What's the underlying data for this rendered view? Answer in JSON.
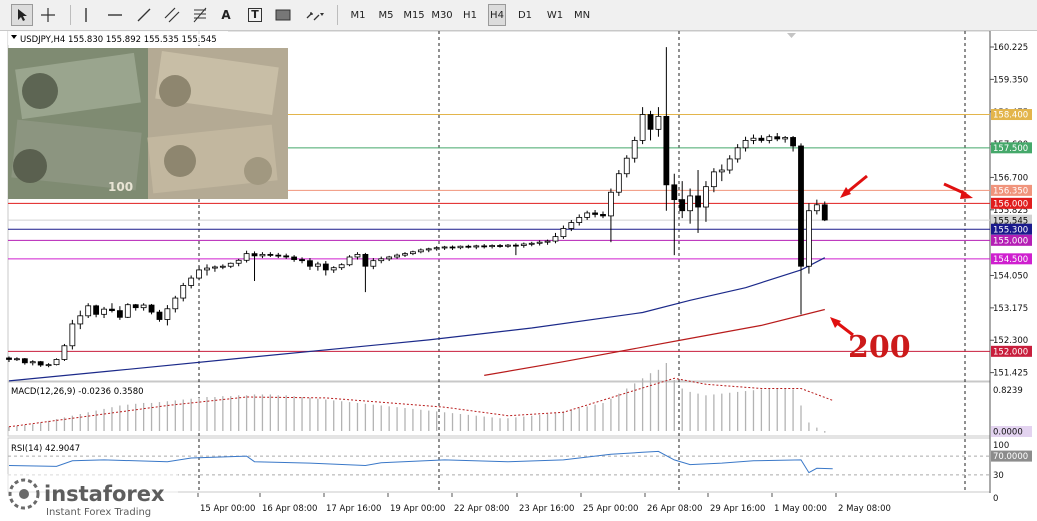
{
  "toolbar": {
    "tools": [
      {
        "name": "cursor-icon"
      },
      {
        "name": "crosshair-icon"
      },
      {
        "name": "vertical-line-icon"
      },
      {
        "name": "horizontal-line-icon"
      },
      {
        "name": "trendline-icon"
      },
      {
        "name": "equidistant-channel-icon"
      },
      {
        "name": "fibonacci-icon"
      },
      {
        "name": "text-icon",
        "glyph": "A"
      },
      {
        "name": "text-label-icon",
        "glyph": "T"
      },
      {
        "name": "rectangle-shape-icon"
      },
      {
        "name": "arrows-menu-icon"
      }
    ],
    "timeframes": [
      "M1",
      "M5",
      "M15",
      "M30",
      "H1",
      "H4",
      "D1",
      "W1",
      "MN"
    ],
    "active_timeframe": "H4"
  },
  "header": {
    "symbol_line": "USDJPY,H4  155.830 155.892 155.535 155.545"
  },
  "price_axis": {
    "ticks": [
      "160.225",
      "159.350",
      "158.475",
      "157.600",
      "156.700",
      "155.825",
      "154.050",
      "153.175",
      "152.300",
      "151.425"
    ]
  },
  "levels": [
    {
      "label": "158.400",
      "value": 158.4,
      "color": "#e3b54b",
      "text_color": "#ffffff"
    },
    {
      "label": "157.500",
      "value": 157.5,
      "color": "#45a86a",
      "text_color": "#ffffff"
    },
    {
      "label": "156.350",
      "value": 156.35,
      "color": "#f0947c",
      "text_color": "#ffffff"
    },
    {
      "label": "156.000",
      "value": 156.0,
      "color": "#e11d1d",
      "text_color": "#ffffff"
    },
    {
      "label": "155.545",
      "value": 155.545,
      "color": "#d2d2d2",
      "text_color": "#000000"
    },
    {
      "label": "155.300",
      "value": 155.3,
      "color": "#1a1a8c",
      "text_color": "#ffffff"
    },
    {
      "label": "155.000",
      "value": 155.0,
      "color": "#b51fb5",
      "text_color": "#ffffff"
    },
    {
      "label": "154.500",
      "value": 154.5,
      "color": "#cf1fcf",
      "text_color": "#ffffff"
    },
    {
      "label": "152.000",
      "value": 152.0,
      "color": "#c81e3c",
      "text_color": "#ffffff"
    }
  ],
  "macd": {
    "label": "MACD(12,26,9) -0.0236 0.3580",
    "axis_top": "0.8239",
    "axis_zero": "0.0000"
  },
  "rsi": {
    "label": "RSI(14) 42.9047",
    "axis": [
      "100",
      "70.0000",
      "30",
      "0"
    ]
  },
  "time_axis": [
    "15 Apr 00:00",
    "16 Apr 08:00",
    "17 Apr 16:00",
    "19 Apr 00:00",
    "22 Apr 08:00",
    "23 Apr 16:00",
    "25 Apr 00:00",
    "26 Apr 08:00",
    "29 Apr 16:00",
    "1 May 00:00",
    "2 May 08:00"
  ],
  "annotation": {
    "text": "200",
    "color": "#cc1a1a"
  },
  "watermark": {
    "brand": "instaforex",
    "tagline": "Instant Forex Trading"
  },
  "chart_data": {
    "type": "candlestick",
    "symbol": "USDJPY",
    "timeframe": "H4",
    "y_range": [
      151.2,
      160.55
    ],
    "candles": [
      [
        151.82,
        151.86,
        151.71,
        151.78
      ],
      [
        151.78,
        151.84,
        151.74,
        151.8
      ],
      [
        151.8,
        151.82,
        151.64,
        151.69
      ],
      [
        151.69,
        151.76,
        151.62,
        151.72
      ],
      [
        151.72,
        151.74,
        151.58,
        151.63
      ],
      [
        151.63,
        151.68,
        151.57,
        151.64
      ],
      [
        151.64,
        151.81,
        151.62,
        151.78
      ],
      [
        151.78,
        152.2,
        151.74,
        152.15
      ],
      [
        152.15,
        152.85,
        152.05,
        152.74
      ],
      [
        152.74,
        153.1,
        152.6,
        152.96
      ],
      [
        152.96,
        153.3,
        152.9,
        153.23
      ],
      [
        153.23,
        153.26,
        152.92,
        153.0
      ],
      [
        153.0,
        153.2,
        152.9,
        153.14
      ],
      [
        153.14,
        153.3,
        153.05,
        153.1
      ],
      [
        153.1,
        153.22,
        152.85,
        152.92
      ],
      [
        152.92,
        153.3,
        152.9,
        153.26
      ],
      [
        153.26,
        153.28,
        153.1,
        153.18
      ],
      [
        153.18,
        153.3,
        153.1,
        153.25
      ],
      [
        153.25,
        153.28,
        153.0,
        153.06
      ],
      [
        153.06,
        153.12,
        152.8,
        152.86
      ],
      [
        152.86,
        153.25,
        152.7,
        153.15
      ],
      [
        153.15,
        153.5,
        153.05,
        153.44
      ],
      [
        153.44,
        153.85,
        153.35,
        153.78
      ],
      [
        153.78,
        154.05,
        153.7,
        153.98
      ],
      [
        153.98,
        154.3,
        153.92,
        154.2
      ],
      [
        154.2,
        154.35,
        154.05,
        154.25
      ],
      [
        154.25,
        154.32,
        154.15,
        154.28
      ],
      [
        154.28,
        154.35,
        154.22,
        154.3
      ],
      [
        154.3,
        154.4,
        154.25,
        154.38
      ],
      [
        154.38,
        154.5,
        154.3,
        154.46
      ],
      [
        154.46,
        154.72,
        154.4,
        154.64
      ],
      [
        154.64,
        154.7,
        153.9,
        154.58
      ],
      [
        154.58,
        154.68,
        154.52,
        154.62
      ],
      [
        154.62,
        154.68,
        154.55,
        154.6
      ],
      [
        154.6,
        154.66,
        154.52,
        154.58
      ],
      [
        154.58,
        154.64,
        154.5,
        154.55
      ],
      [
        154.55,
        154.6,
        154.42,
        154.48
      ],
      [
        154.48,
        154.54,
        154.38,
        154.45
      ],
      [
        154.45,
        154.52,
        154.2,
        154.3
      ],
      [
        154.3,
        154.42,
        154.18,
        154.36
      ],
      [
        154.36,
        154.44,
        154.05,
        154.2
      ],
      [
        154.2,
        154.3,
        154.12,
        154.26
      ],
      [
        154.26,
        154.38,
        154.2,
        154.34
      ],
      [
        154.34,
        154.6,
        154.3,
        154.55
      ],
      [
        154.55,
        154.68,
        154.48,
        154.62
      ],
      [
        154.62,
        154.66,
        153.6,
        154.3
      ],
      [
        154.3,
        154.52,
        154.22,
        154.45
      ],
      [
        154.45,
        154.56,
        154.38,
        154.5
      ],
      [
        154.5,
        154.58,
        154.44,
        154.55
      ],
      [
        154.55,
        154.64,
        154.5,
        154.6
      ],
      [
        154.6,
        154.68,
        154.55,
        154.64
      ],
      [
        154.64,
        154.72,
        154.6,
        154.69
      ],
      [
        154.69,
        154.78,
        154.65,
        154.74
      ],
      [
        154.74,
        154.8,
        154.68,
        154.77
      ],
      [
        154.77,
        154.84,
        154.72,
        154.8
      ],
      [
        154.8,
        154.85,
        154.74,
        154.82
      ],
      [
        154.82,
        154.86,
        154.74,
        154.8
      ],
      [
        154.8,
        154.86,
        154.76,
        154.84
      ],
      [
        154.84,
        154.88,
        154.78,
        154.82
      ],
      [
        154.82,
        154.88,
        154.76,
        154.85
      ],
      [
        154.85,
        154.9,
        154.78,
        154.83
      ],
      [
        154.83,
        154.89,
        154.78,
        154.86
      ],
      [
        154.86,
        154.9,
        154.8,
        154.84
      ],
      [
        154.84,
        154.9,
        154.8,
        154.87
      ],
      [
        154.87,
        154.92,
        154.6,
        154.86
      ],
      [
        154.86,
        154.94,
        154.8,
        154.9
      ],
      [
        154.9,
        154.96,
        154.84,
        154.92
      ],
      [
        154.92,
        155.0,
        154.86,
        154.95
      ],
      [
        154.95,
        155.02,
        154.88,
        154.98
      ],
      [
        154.98,
        155.2,
        154.92,
        155.1
      ],
      [
        155.1,
        155.4,
        155.04,
        155.32
      ],
      [
        155.32,
        155.55,
        155.25,
        155.48
      ],
      [
        155.48,
        155.7,
        155.4,
        155.62
      ],
      [
        155.62,
        155.8,
        155.55,
        155.74
      ],
      [
        155.74,
        155.82,
        155.62,
        155.7
      ],
      [
        155.7,
        155.78,
        155.6,
        155.66
      ],
      [
        155.66,
        156.4,
        154.95,
        156.3
      ],
      [
        156.3,
        156.9,
        156.2,
        156.8
      ],
      [
        156.8,
        157.3,
        156.7,
        157.22
      ],
      [
        157.22,
        157.8,
        157.1,
        157.7
      ],
      [
        157.7,
        158.6,
        157.6,
        158.4
      ],
      [
        158.4,
        158.5,
        157.7,
        158.0
      ],
      [
        158.0,
        158.6,
        157.8,
        158.35
      ],
      [
        158.35,
        160.22,
        155.8,
        156.5
      ],
      [
        156.5,
        156.8,
        154.6,
        156.1
      ],
      [
        156.1,
        156.6,
        155.6,
        155.8
      ],
      [
        155.8,
        156.4,
        155.45,
        156.2
      ],
      [
        156.2,
        156.9,
        155.2,
        155.9
      ],
      [
        155.9,
        156.6,
        155.5,
        156.45
      ],
      [
        156.45,
        156.95,
        156.3,
        156.85
      ],
      [
        156.85,
        157.05,
        156.6,
        156.9
      ],
      [
        156.9,
        157.3,
        156.8,
        157.2
      ],
      [
        157.2,
        157.6,
        157.1,
        157.5
      ],
      [
        157.5,
        157.8,
        157.4,
        157.7
      ],
      [
        157.7,
        157.86,
        157.6,
        157.76
      ],
      [
        157.76,
        157.84,
        157.64,
        157.7
      ],
      [
        157.7,
        157.86,
        157.62,
        157.8
      ],
      [
        157.8,
        157.9,
        157.68,
        157.74
      ],
      [
        157.74,
        157.82,
        157.64,
        157.78
      ],
      [
        157.78,
        157.82,
        157.4,
        157.55
      ],
      [
        157.55,
        157.62,
        153.0,
        154.3
      ],
      [
        154.3,
        156.0,
        154.1,
        155.8
      ],
      [
        155.8,
        156.1,
        155.7,
        155.96
      ],
      [
        155.96,
        156.05,
        155.52,
        155.55
      ]
    ],
    "ma_blue": [
      [
        0,
        151.2
      ],
      [
        13,
        151.47
      ],
      [
        30,
        151.83
      ],
      [
        53,
        152.31
      ],
      [
        66,
        152.63
      ],
      [
        80,
        153.05
      ],
      [
        86,
        153.38
      ],
      [
        93,
        153.72
      ],
      [
        100,
        154.2
      ],
      [
        103,
        154.53
      ]
    ],
    "ma_red": [
      [
        60,
        151.35
      ],
      [
        70,
        151.72
      ],
      [
        85,
        152.31
      ],
      [
        95,
        152.7
      ],
      [
        103,
        153.13
      ]
    ],
    "macd_hist": [
      0.05,
      0.06,
      0.07,
      0.08,
      0.1,
      0.12,
      0.14,
      0.16,
      0.18,
      0.2,
      0.22,
      0.24,
      0.26,
      0.28,
      0.3,
      0.31,
      0.32,
      0.33,
      0.33,
      0.34,
      0.35,
      0.36,
      0.37,
      0.38,
      0.39,
      0.4,
      0.4,
      0.41,
      0.41,
      0.42,
      0.42,
      0.43,
      0.43,
      0.43,
      0.42,
      0.42,
      0.41,
      0.4,
      0.39,
      0.38,
      0.37,
      0.36,
      0.35,
      0.34,
      0.33,
      0.32,
      0.31,
      0.3,
      0.29,
      0.28,
      0.27,
      0.26,
      0.25,
      0.24,
      0.23,
      0.22,
      0.21,
      0.2,
      0.19,
      0.18,
      0.17,
      0.16,
      0.15,
      0.15,
      0.16,
      0.17,
      0.18,
      0.19,
      0.2,
      0.21,
      0.23,
      0.25,
      0.27,
      0.29,
      0.31,
      0.33,
      0.38,
      0.44,
      0.5,
      0.56,
      0.62,
      0.68,
      0.72,
      0.8,
      0.6,
      0.5,
      0.46,
      0.44,
      0.42,
      0.43,
      0.44,
      0.45,
      0.46,
      0.47,
      0.48,
      0.49,
      0.5,
      0.5,
      0.5,
      0.49,
      0.3,
      0.1,
      0.04,
      -0.02
    ],
    "macd_signal": [
      [
        0,
        0.05
      ],
      [
        20,
        0.3
      ],
      [
        30,
        0.4
      ],
      [
        40,
        0.39
      ],
      [
        55,
        0.28
      ],
      [
        63,
        0.18
      ],
      [
        70,
        0.22
      ],
      [
        78,
        0.45
      ],
      [
        84,
        0.62
      ],
      [
        88,
        0.55
      ],
      [
        95,
        0.5
      ],
      [
        100,
        0.5
      ],
      [
        104,
        0.36
      ]
    ],
    "rsi": [
      [
        0,
        50
      ],
      [
        6,
        48
      ],
      [
        8,
        60
      ],
      [
        12,
        62
      ],
      [
        20,
        58
      ],
      [
        23,
        66
      ],
      [
        30,
        70
      ],
      [
        31,
        58
      ],
      [
        38,
        55
      ],
      [
        45,
        50
      ],
      [
        47,
        56
      ],
      [
        55,
        62
      ],
      [
        63,
        58
      ],
      [
        70,
        62
      ],
      [
        76,
        74
      ],
      [
        80,
        78
      ],
      [
        82,
        80
      ],
      [
        84,
        62
      ],
      [
        86,
        52
      ],
      [
        90,
        55
      ],
      [
        94,
        60
      ],
      [
        100,
        62
      ],
      [
        101,
        35
      ],
      [
        102,
        44
      ],
      [
        104,
        43
      ]
    ]
  }
}
